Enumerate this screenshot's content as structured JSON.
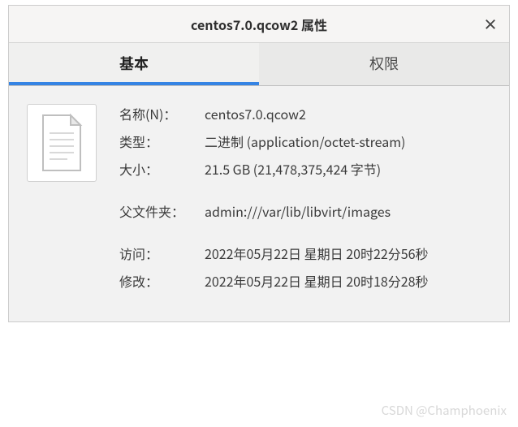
{
  "titlebar": {
    "title": "centos7.0.qcow2 属性",
    "close": "×"
  },
  "tabs": {
    "basic": "基本",
    "permissions": "权限"
  },
  "properties": {
    "name": {
      "label": "名称(N)：",
      "value": "centos7.0.qcow2"
    },
    "type": {
      "label": "类型：",
      "value": "二进制 (application/octet-stream)"
    },
    "size": {
      "label": "大小：",
      "value": "21.5 GB (21,478,375,424 字节)"
    },
    "parent": {
      "label": "父文件夹：",
      "value": "admin:///var/lib/libvirt/images"
    },
    "accessed": {
      "label": "访问：",
      "value": "2022年05月22日  星期日  20时22分56秒"
    },
    "modified": {
      "label": "修改：",
      "value": "2022年05月22日  星期日  20时18分28秒"
    }
  },
  "watermark": "CSDN @Champhoenix"
}
